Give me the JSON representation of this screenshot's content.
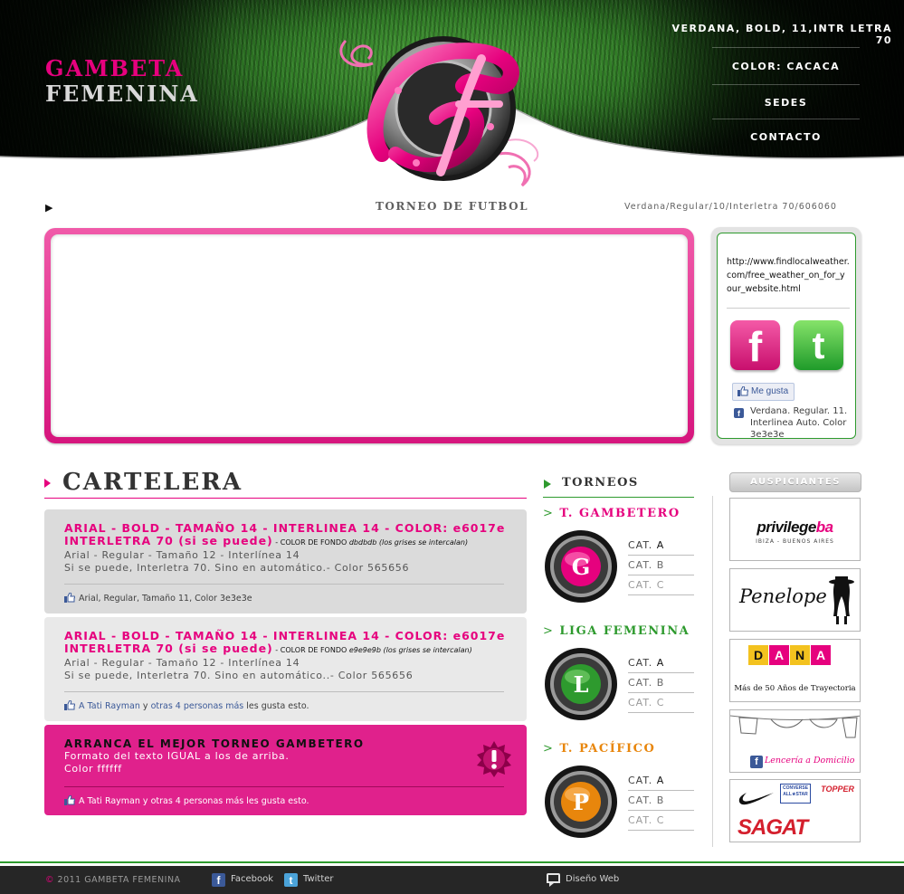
{
  "header": {
    "brand_line1": "GAMBETA",
    "brand_line2": "FEMENINA",
    "nav": [
      {
        "label": "VERDANA, BOLD, 11,INTR LETRA 70"
      },
      {
        "label": "COLOR: CACACA"
      },
      {
        "label": "SEDES"
      },
      {
        "label": "CONTACTO"
      }
    ]
  },
  "title_row": {
    "title": "TORNEO DE FUTBOL",
    "note": "Verdana/Regular/10/Interletra 70/606060"
  },
  "widget": {
    "weather_url": "http://www.findlocalweather.com/free_weather_on_for_your_website.html",
    "like_label": "Me gusta",
    "fb_note": "Verdana. Regular. 11. Interlinea Auto. Color 3e3e3e"
  },
  "cartelera": {
    "title": "CARTELERA",
    "posts": [
      {
        "head": "ARIAL - BOLD - TAMAÑO 14 - INTERLINEA 14 - COLOR: e6017e INTERLETRA 70 (si se puede)",
        "bg_note_prefix": " - COLOR DE FONDO ",
        "bg_note_italic": "dbdbdb (los grises se intercalan)",
        "body_line1": "Arial - Regular - Tamaño 12 - Interlínea 14",
        "body_line2": "Si se puede, Interletra 70. Sino en automático.- Color 565656",
        "foot_text": "Arial, Regular, Tamaño 11, Color 3e3e3e"
      },
      {
        "head": "ARIAL - BOLD - TAMAÑO 14 - INTERLINEA 14 - COLOR: e6017e INTERLETRA 70 (si se puede)",
        "bg_note_prefix": " - COLOR DE FONDO ",
        "bg_note_italic": "e9e9e9b (los grises se intercalan)",
        "body_line1": "Arial - Regular - Tamaño 12 - Interlínea 14",
        "body_line2": "Si se puede, Interletra 70. Sino en automático..- Color 565656",
        "foot_a": "A ",
        "foot_name": "Tati Rayman",
        "foot_and": " y ",
        "foot_others": "otras 4 personas más",
        "foot_tail": " les gusta esto."
      },
      {
        "head": "ARRANCA EL MEJOR TORNEO GAMBETERO",
        "body_line1": "Formato del texto IGUAL a los de arriba.",
        "body_line2": "Color ffffff",
        "foot_a": "A ",
        "foot_name": "Tati Rayman",
        "foot_and": " y ",
        "foot_others": "otras 4 personas más",
        "foot_tail": " les gusta esto."
      }
    ]
  },
  "torneos": {
    "title": "TORNEOS",
    "items": [
      {
        "title": "T. GAMBETERO",
        "letter": "G",
        "color": "#e6017e",
        "cats": [
          {
            "prefix": "CAT. ",
            "letter": "A"
          },
          {
            "prefix": "CAT. ",
            "letter": "B"
          },
          {
            "prefix": "CAT. ",
            "letter": "C"
          }
        ]
      },
      {
        "title": "LIGA FEMENINA",
        "letter": "L",
        "color": "#2e9a2e",
        "cats": [
          {
            "prefix": "CAT. ",
            "letter": "A"
          },
          {
            "prefix": "CAT. ",
            "letter": "B"
          },
          {
            "prefix": "CAT. ",
            "letter": "C"
          }
        ]
      },
      {
        "title": "T. PACÍFICO",
        "letter": "P",
        "color": "#e8860c",
        "cats": [
          {
            "prefix": "CAT. ",
            "letter": "A"
          },
          {
            "prefix": "CAT. ",
            "letter": "B"
          },
          {
            "prefix": "CAT. ",
            "letter": "C"
          }
        ]
      }
    ]
  },
  "sponsors": {
    "title": "AUSPICIANTES",
    "privilege_main": "privilege",
    "privilege_ba": "ba",
    "privilege_sub": "IBIZA - BUENOS AIRES",
    "penelope": "Penelope",
    "dana_letters": [
      "D",
      "A",
      "N",
      "A"
    ],
    "dana_sub": "Más de 50 Años de Trayectoria",
    "lenceria": "Lencería a Domicilio",
    "converse": "CONVERSE ALL★STAR",
    "topper": "TOPPER",
    "sagat": "SAGAT"
  },
  "footer": {
    "copyright_symbol": "©",
    "copyright": " 2011 GAMBETA FEMENINA",
    "facebook": "Facebook",
    "twitter": "Twitter",
    "diseno": "Diseño Web"
  },
  "colors": {
    "accent": "#e6017e",
    "green": "#2e9a2e",
    "orange": "#e8860c",
    "text": "#3e3e3e"
  }
}
